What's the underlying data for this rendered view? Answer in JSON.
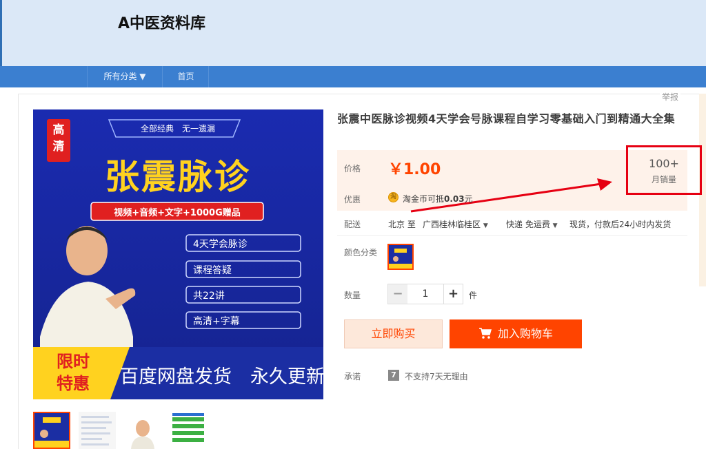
{
  "header": {
    "shop_name": "A中医资料库"
  },
  "nav": {
    "all_categories": "所有分类 ▼",
    "home": "首页"
  },
  "report": "举报",
  "product": {
    "title": "张震中医脉诊视频4天学会号脉课程自学习零基础入门到精通大全集",
    "price_label": "价格",
    "price": "￥1.00",
    "monthly_sales_value": "100+",
    "monthly_sales_label": "月销量",
    "promo_label": "优惠",
    "promo_coin_icon": "淘",
    "promo_text_prefix": "淘金币可抵",
    "promo_amount": "0.03",
    "promo_text_suffix": "元",
    "shipping_label": "配送",
    "ship_from": "北京 至",
    "ship_to": "广西桂林临桂区",
    "ship_fee": "快递 免运费",
    "ship_note": "现货，付款后24小时内发货",
    "color_label": "颜色分类",
    "qty_label": "数量",
    "qty_value": "1",
    "qty_minus": "−",
    "qty_plus": "+",
    "qty_unit": "件",
    "buy_now": "立即购买",
    "add_cart": "加入购物车",
    "promise_label": "承诺",
    "promise_icon": "7",
    "promise_text": "不支持7天无理由"
  },
  "main_image": {
    "badge": "高\n清",
    "tagline": "全部经典　无一遗漏",
    "name": "张震脉诊",
    "bonus": "视频+音频+文字+1000G赠品",
    "features": [
      "4天学会脉诊",
      "课程答疑",
      "共22讲",
      "高清+字幕"
    ],
    "limited": "限时\n特惠",
    "delivery": "百度网盘发货　永久更新"
  },
  "colors": {
    "accent": "#ff4400",
    "nav": "#3b7fd0",
    "header_bg": "#dbe8f7"
  }
}
